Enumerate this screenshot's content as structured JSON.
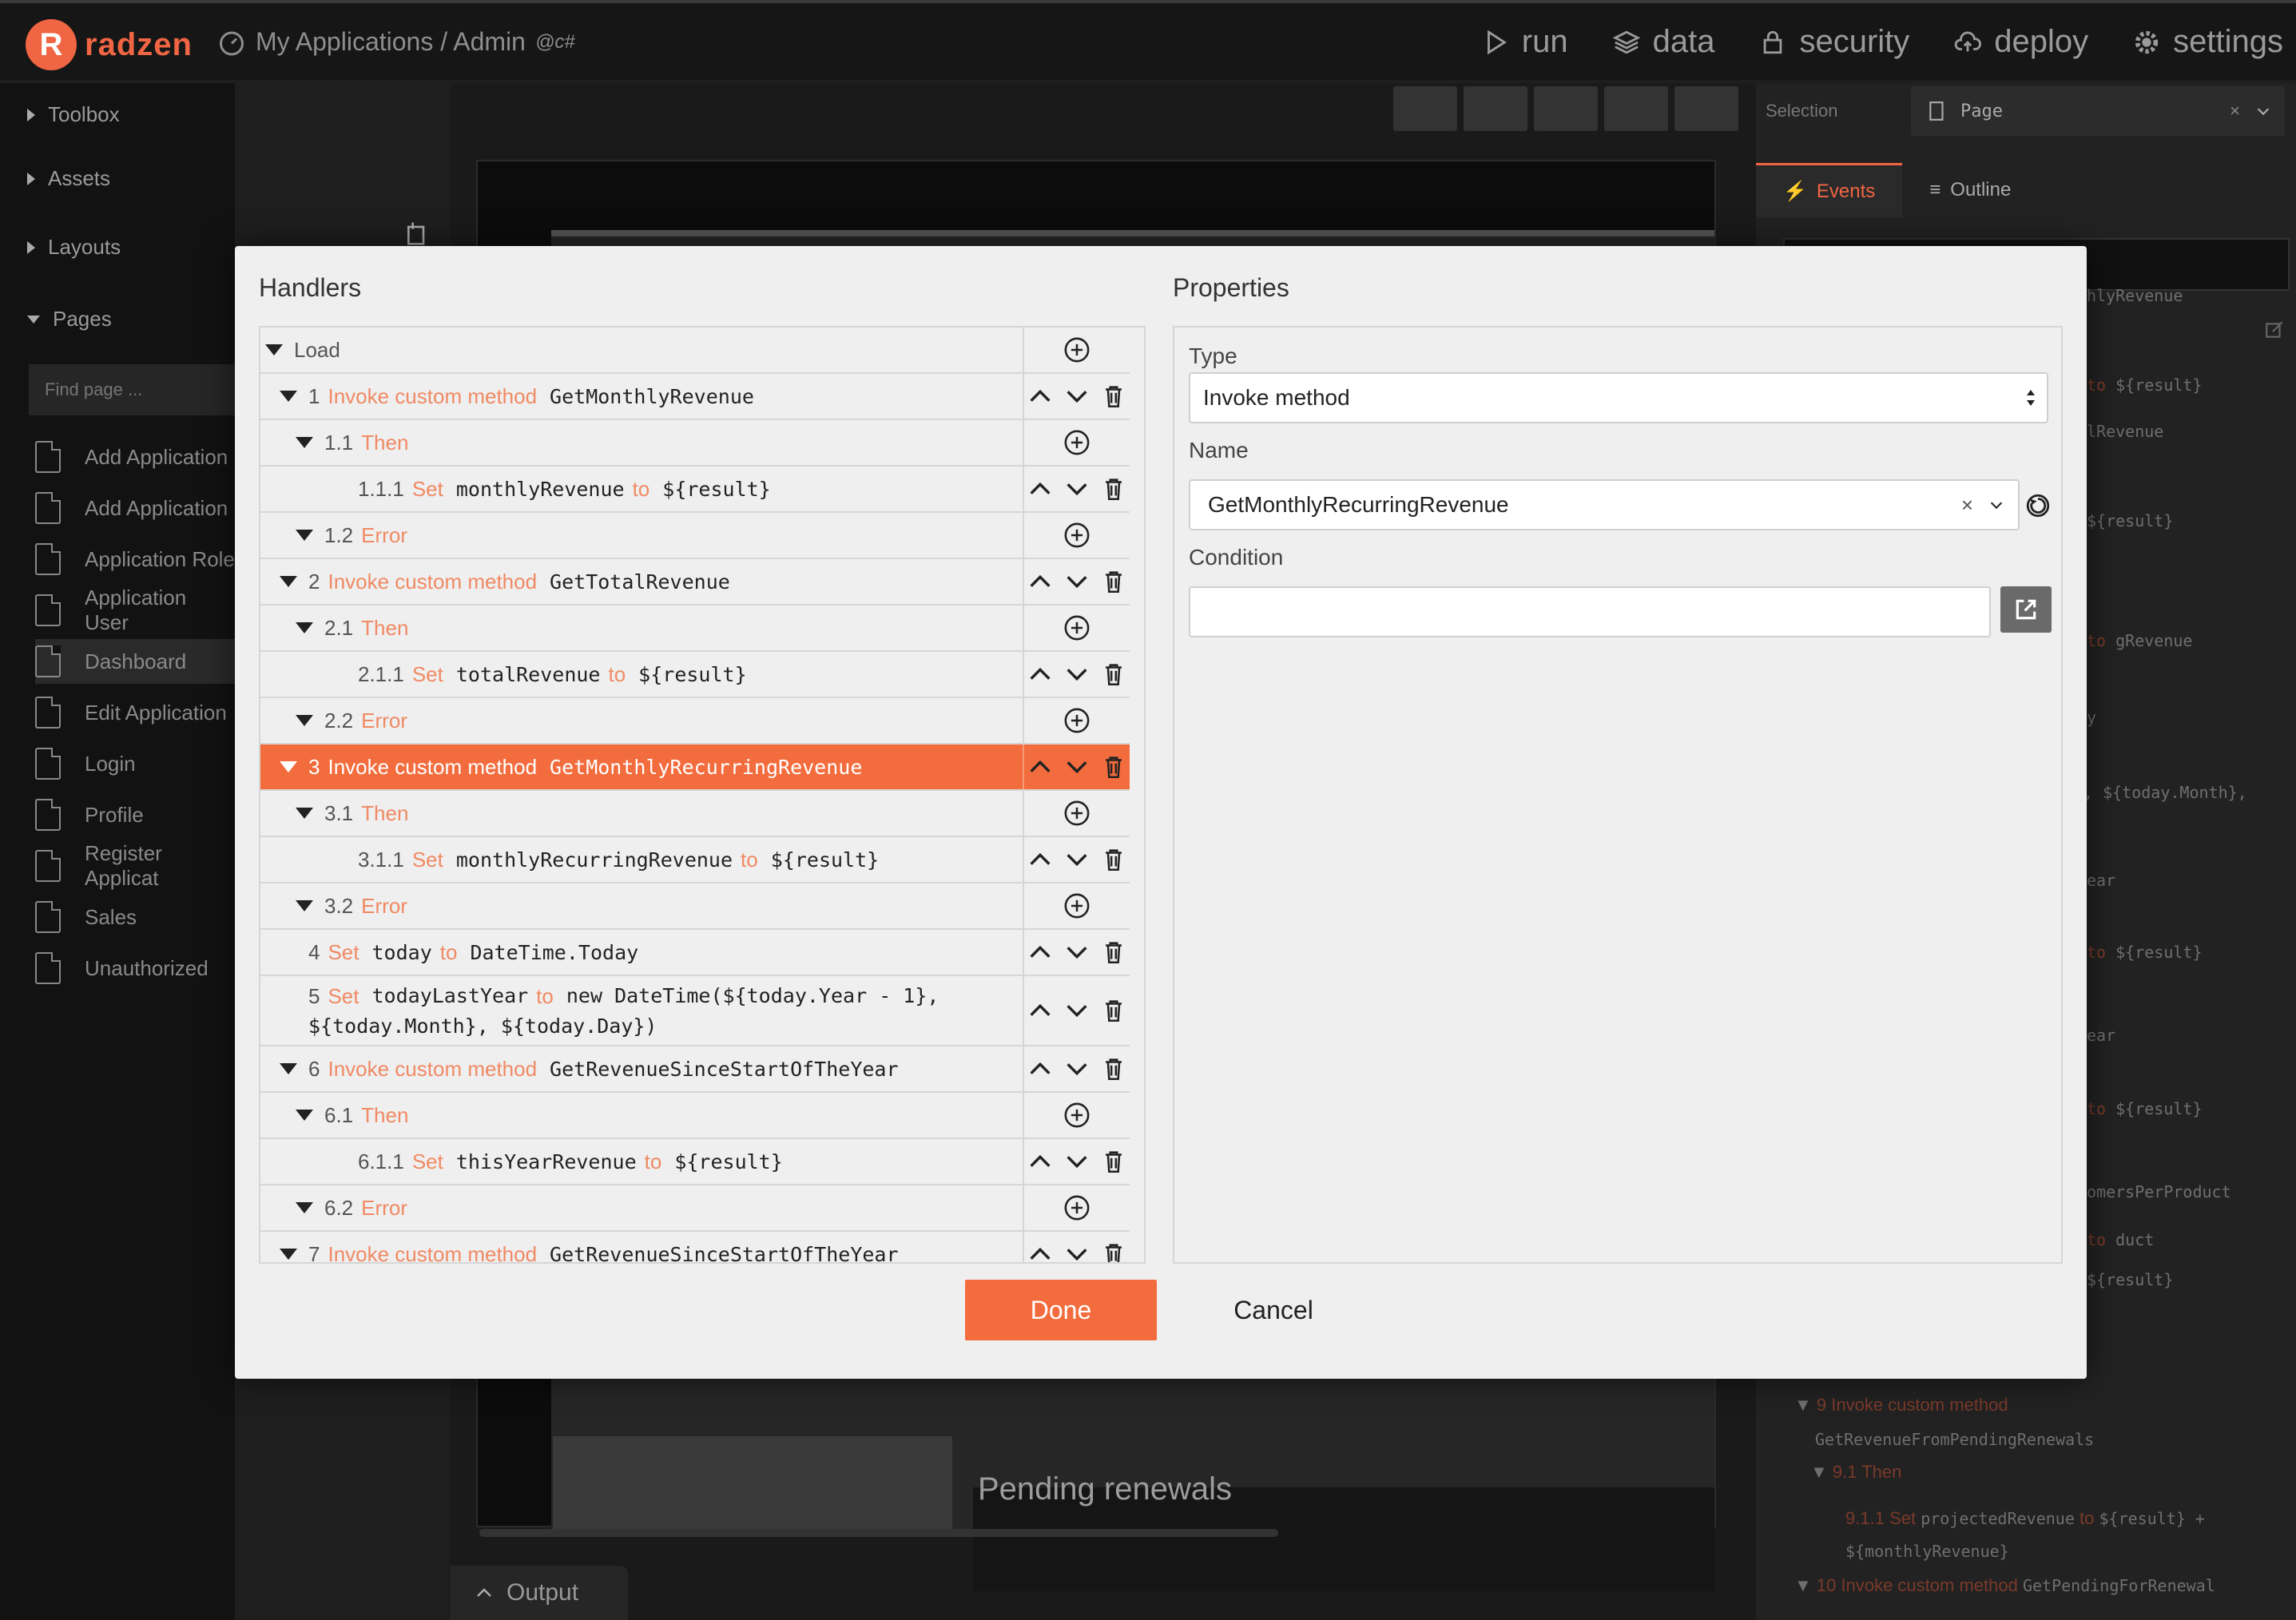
{
  "app": {
    "brand": "radzen",
    "breadcrumb": "My Applications / Admin",
    "lang_badge": "c#"
  },
  "topnav": [
    {
      "id": "run",
      "label": "run",
      "icon": "play-icon"
    },
    {
      "id": "data",
      "label": "data",
      "icon": "layers-icon"
    },
    {
      "id": "security",
      "label": "security",
      "icon": "lock-icon"
    },
    {
      "id": "deploy",
      "label": "deploy",
      "icon": "cloud-upload-icon"
    },
    {
      "id": "settings",
      "label": "settings",
      "icon": "gear-icon"
    }
  ],
  "sidebar": {
    "sections": [
      "Toolbox",
      "Assets",
      "Layouts",
      "Pages"
    ],
    "find_placeholder": "Find page ...",
    "pages": [
      "Add Application",
      "Add Application",
      "Application Role",
      "Application User",
      "Dashboard",
      "Edit Application",
      "Login",
      "Profile",
      "Register Applicat",
      "Sales",
      "Unauthorized"
    ],
    "active_page": "Dashboard"
  },
  "canvas": {
    "pending_heading": "Pending renewals",
    "output_tab": "Output"
  },
  "rightpanel": {
    "selection_label": "Selection",
    "selection_value": "Page",
    "tabs": {
      "events": "Events",
      "outline": "Outline"
    },
    "ghost": [
      "hlyRevenue",
      "${result}",
      "lRevenue",
      "${result}",
      "gRevenue",
      "y",
      ", ${today.Month},",
      "ear",
      "${result}",
      "ear",
      "${result}",
      "omersPerProduct",
      "duct",
      "${result}"
    ],
    "ghost_to": "to",
    "tree_tail": {
      "item9": "9 Invoke custom method",
      "item9_method": "GetRevenueFromPendingRenewals",
      "item9_then": "9.1 Then",
      "item911_num": "9.1.1",
      "item911_set": "Set",
      "item911_target": "projectedRevenue",
      "item911_to": "to",
      "item911_value": "${result} +",
      "item911_value2": "${monthlyRevenue}",
      "item10": "10 Invoke custom method",
      "item10_method": "GetPendingForRenewal"
    }
  },
  "modal": {
    "handlers_title": "Handlers",
    "properties_title": "Properties",
    "rows": [
      {
        "num": "Load",
        "kw": "",
        "text": "",
        "to": "",
        "val": "",
        "indent": 0,
        "tri": true,
        "kind": "add"
      },
      {
        "num": "1",
        "kw": "Invoke custom method",
        "text": "GetMonthlyRevenue",
        "to": "",
        "val": "",
        "indent": 1,
        "tri": true,
        "kind": "move"
      },
      {
        "num": "1.1",
        "kw": "Then",
        "text": "",
        "to": "",
        "val": "",
        "indent": 2,
        "tri": true,
        "kind": "add"
      },
      {
        "num": "1.1.1",
        "kw": "Set",
        "text": "monthlyRevenue",
        "to": "to",
        "val": "${result}",
        "indent": 3,
        "tri": false,
        "kind": "move"
      },
      {
        "num": "1.2",
        "kw": "Error",
        "text": "",
        "to": "",
        "val": "",
        "indent": 2,
        "tri": true,
        "kind": "add"
      },
      {
        "num": "2",
        "kw": "Invoke custom method",
        "text": "GetTotalRevenue",
        "to": "",
        "val": "",
        "indent": 1,
        "tri": true,
        "kind": "move"
      },
      {
        "num": "2.1",
        "kw": "Then",
        "text": "",
        "to": "",
        "val": "",
        "indent": 2,
        "tri": true,
        "kind": "add"
      },
      {
        "num": "2.1.1",
        "kw": "Set",
        "text": "totalRevenue",
        "to": "to",
        "val": "${result}",
        "indent": 3,
        "tri": false,
        "kind": "move"
      },
      {
        "num": "2.2",
        "kw": "Error",
        "text": "",
        "to": "",
        "val": "",
        "indent": 2,
        "tri": true,
        "kind": "add"
      },
      {
        "num": "3",
        "kw": "Invoke custom method",
        "text": "GetMonthlyRecurringRevenue",
        "to": "",
        "val": "",
        "indent": 1,
        "tri": true,
        "kind": "move",
        "selected": true
      },
      {
        "num": "3.1",
        "kw": "Then",
        "text": "",
        "to": "",
        "val": "",
        "indent": 2,
        "tri": true,
        "kind": "add"
      },
      {
        "num": "3.1.1",
        "kw": "Set",
        "text": "monthlyRecurringRevenue",
        "to": "to",
        "val": "${result}",
        "indent": 3,
        "tri": false,
        "kind": "move"
      },
      {
        "num": "3.2",
        "kw": "Error",
        "text": "",
        "to": "",
        "val": "",
        "indent": 2,
        "tri": true,
        "kind": "add"
      },
      {
        "num": "4",
        "kw": "Set",
        "text": "today",
        "to": "to",
        "val": "DateTime.Today",
        "indent": 1,
        "tri": false,
        "kind": "move"
      },
      {
        "num": "5",
        "kw": "Set",
        "text": "todayLastYear",
        "to": "to",
        "val": "new DateTime(${today.Year - 1},",
        "val2": "${today.Month}, ${today.Day})",
        "indent": 1,
        "tri": false,
        "kind": "move",
        "tall": true
      },
      {
        "num": "6",
        "kw": "Invoke custom method",
        "text": "GetRevenueSinceStartOfTheYear",
        "to": "",
        "val": "",
        "indent": 1,
        "tri": true,
        "kind": "move"
      },
      {
        "num": "6.1",
        "kw": "Then",
        "text": "",
        "to": "",
        "val": "",
        "indent": 2,
        "tri": true,
        "kind": "add"
      },
      {
        "num": "6.1.1",
        "kw": "Set",
        "text": "thisYearRevenue",
        "to": "to",
        "val": "${result}",
        "indent": 3,
        "tri": false,
        "kind": "move"
      },
      {
        "num": "6.2",
        "kw": "Error",
        "text": "",
        "to": "",
        "val": "",
        "indent": 2,
        "tri": true,
        "kind": "add"
      },
      {
        "num": "7",
        "kw": "Invoke custom method",
        "text": "GetRevenueSinceStartOfTheYear",
        "to": "",
        "val": "",
        "indent": 1,
        "tri": true,
        "kind": "move"
      }
    ],
    "properties": {
      "type_label": "Type",
      "type_value": "Invoke method",
      "name_label": "Name",
      "name_value": "GetMonthlyRecurringRevenue",
      "condition_label": "Condition",
      "condition_value": ""
    },
    "done_label": "Done",
    "cancel_label": "Cancel"
  },
  "colors": {
    "accent": "#f36c3d",
    "brand": "#f06543"
  }
}
